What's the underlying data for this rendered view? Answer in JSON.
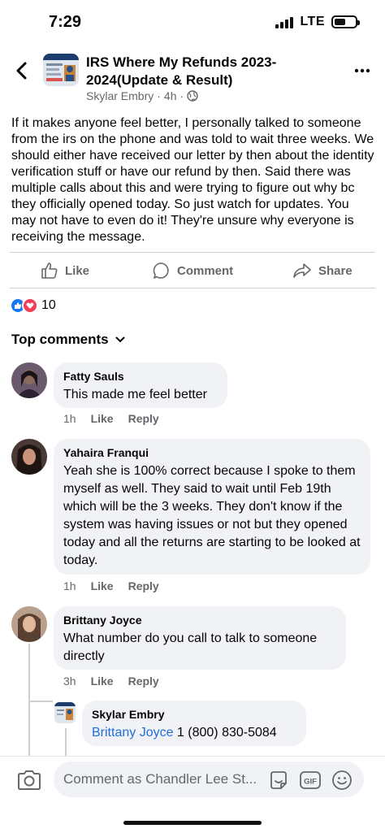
{
  "status_bar": {
    "time": "7:29",
    "network": "LTE",
    "battery_level": 0.55
  },
  "header": {
    "group_name": "IRS Where My Refunds 2023-2024(Update & Result)",
    "author": "Skylar Embry",
    "time": "4h",
    "separator": "·"
  },
  "post": {
    "text": "If it makes anyone feel better, I personally talked to someone from the irs on the phone and was told to wait three weeks. We should either have received our letter by then about the identity verification stuff or have our refund by then. Said there was multiple calls about this and were trying to figure out why bc they officially opened today. So just watch for updates. You may not have to even do it! They're unsure why everyone is receiving the message."
  },
  "actions": {
    "like": "Like",
    "comment": "Comment",
    "share": "Share"
  },
  "reactions": {
    "count": "10",
    "colors": {
      "like": "#1877f2",
      "love": "#f33e58"
    }
  },
  "comments_section": {
    "heading": "Top comments"
  },
  "comments": [
    {
      "name": "Fatty Sauls",
      "text": "This made me feel better",
      "time": "1h",
      "like": "Like",
      "reply": "Reply"
    },
    {
      "name": "Yahaira Franqui",
      "text": "Yeah she is 100% correct because I spoke to them myself as well. They said to wait until Feb 19th which will be the 3 weeks. They don't know if the system was having issues or not but they opened today and all the returns are starting to be looked at today.",
      "time": "1h",
      "like": "Like",
      "reply": "Reply"
    },
    {
      "name": "Brittany Joyce",
      "text": "What number do you call to talk to someone directly",
      "time": "3h",
      "like": "Like",
      "reply": "Reply"
    }
  ],
  "reply": {
    "name": "Skylar Embry",
    "mention": "Brittany Joyce",
    "text": " 1 (800) 830-5084"
  },
  "input": {
    "placeholder": "Comment as Chandler Lee St..."
  },
  "colors": {
    "accent": "#216fdb",
    "bubble": "#f0f2f5",
    "muted": "#65676b"
  }
}
